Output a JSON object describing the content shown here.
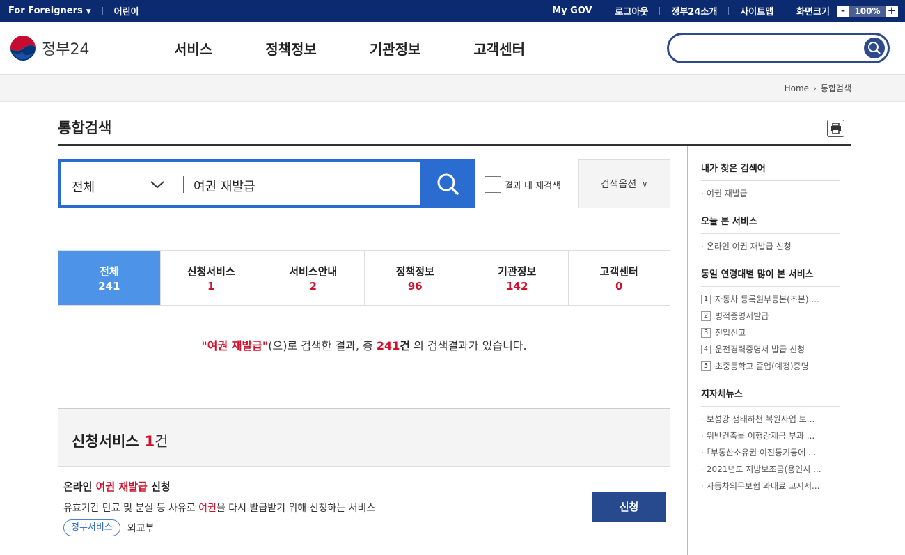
{
  "util": {
    "foreigners": "For Foreigners",
    "kids": "어린이",
    "mygov": "My GOV",
    "logout": "로그아웃",
    "about": "정부24소개",
    "sitemap": "사이트맵",
    "screensize": "화면크기",
    "zoom_minus": "-",
    "zoom_value": "100%",
    "zoom_plus": "+"
  },
  "header": {
    "logo_text": "정부24",
    "menus": [
      "서비스",
      "정책정보",
      "기관정보",
      "고객센터"
    ],
    "search_value": ""
  },
  "breadcrumb": {
    "home": "Home",
    "current": "통합검색"
  },
  "page_title": "통합검색",
  "search": {
    "category": "전체",
    "keyword": "여권 재발급",
    "recheck_label": "결과 내 재검색",
    "options_label": "검색옵션"
  },
  "tabs": [
    {
      "label": "전체",
      "count": "241"
    },
    {
      "label": "신청서비스",
      "count": "1"
    },
    {
      "label": "서비스안내",
      "count": "2"
    },
    {
      "label": "정책정보",
      "count": "96"
    },
    {
      "label": "기관정보",
      "count": "142"
    },
    {
      "label": "고객센터",
      "count": "0"
    }
  ],
  "result": {
    "quote_kw": "\"여권 재발급\"",
    "mid": "(으)로 검색한 결과, 총 ",
    "total": "241",
    "unit": "건",
    "tail": " 의 검색결과가 있습니다."
  },
  "section": {
    "title": "신청서비스",
    "count": "1",
    "unit": "건"
  },
  "item": {
    "title_pre": "온라인 ",
    "title_hl": "여권 재발급",
    "title_post": " 신청",
    "desc_pre": "유효기간 만료 및 분실 등 사유로 ",
    "desc_hl": "여권",
    "desc_post": "을 다시 발급받기 위해 신청하는 서비스",
    "tag": "정부서비스",
    "org": "외교부",
    "apply_label": "신청"
  },
  "sidebar": {
    "recent_title": "내가 찾은 검색어",
    "recent": [
      "여권 재발급"
    ],
    "today_title": "오늘 본 서비스",
    "today": [
      "온라인 여권 재발급 신청"
    ],
    "popular_title": "동일 연령대별 많이 본 서비스",
    "popular": [
      {
        "rank": "1",
        "label": "자동차 등록원부등본(초본) ..."
      },
      {
        "rank": "2",
        "label": "병적증명서발급"
      },
      {
        "rank": "3",
        "label": "전입신고"
      },
      {
        "rank": "4",
        "label": "운전경력증명서 발급 신청"
      },
      {
        "rank": "5",
        "label": "초중등학교 졸업(예정)증명"
      }
    ],
    "news_title": "지자체뉴스",
    "news": [
      "보성강 생태하천 복원사업 보...",
      "위반건축물 이행강제금 부과 ...",
      "「부동산소유권 이전등기등에 ...",
      "2021년도 지방보조금(용인시 ...",
      "자동차의무보험 과태료 고지서..."
    ]
  },
  "colors": {
    "top_bar": "#0b2a6f",
    "accent_blue": "#2a6ccf",
    "active_tab": "#4d94e8",
    "highlight_red": "#d0112b",
    "apply_button": "#274a8e"
  },
  "icons": [
    "caret-down-icon",
    "search-icon",
    "chevron-down-icon",
    "print-icon",
    "breadcrumb-arrow-icon",
    "government-logo-icon"
  ]
}
